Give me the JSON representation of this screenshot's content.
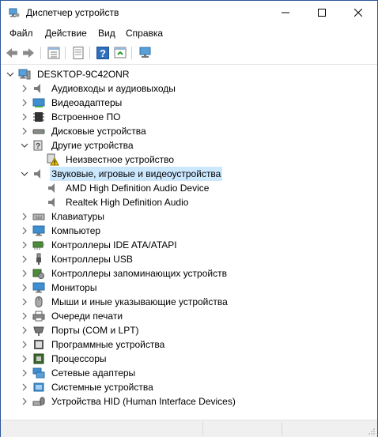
{
  "window": {
    "title": "Диспетчер устройств"
  },
  "menu": {
    "file": "Файл",
    "action": "Действие",
    "view": "Вид",
    "help": "Справка"
  },
  "tree": {
    "root": "DESKTOP-9C42ONR",
    "audio_io": "Аудиовходы и аудиовыходы",
    "video_adapters": "Видеоадаптеры",
    "firmware": "Встроенное ПО",
    "disk_drives": "Дисковые устройства",
    "other_devices": "Другие устройства",
    "unknown_device": "Неизвестное устройство",
    "sound_video_game": "Звуковые, игровые и видеоустройства",
    "amd_audio": "AMD High Definition Audio Device",
    "realtek_audio": "Realtek High Definition Audio",
    "keyboards": "Клавиатуры",
    "computer": "Компьютер",
    "ide": "Контроллеры IDE ATA/ATAPI",
    "usb": "Контроллеры USB",
    "storage": "Контроллеры запоминающих устройств",
    "monitors": "Мониторы",
    "mice": "Мыши и иные указывающие устройства",
    "print_queues": "Очереди печати",
    "ports": "Порты (COM и LPT)",
    "software_devices": "Программные устройства",
    "processors": "Процессоры",
    "network": "Сетевые адаптеры",
    "system": "Системные устройства",
    "hid": "Устройства HID (Human Interface Devices)"
  },
  "colors": {
    "selection": "#cce8ff",
    "window_border": "#2b579a",
    "accent": "#1979ca"
  }
}
